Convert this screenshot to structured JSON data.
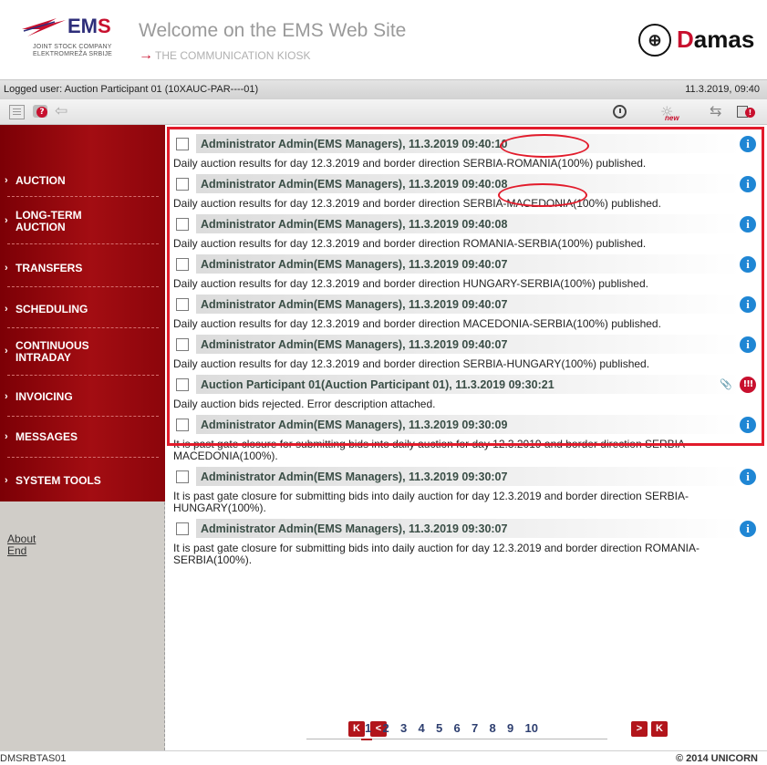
{
  "header": {
    "brand_word_1": "EM",
    "brand_word_2": "S",
    "company_line_1": "JOINT STOCK COMPANY",
    "company_line_2": "ELEKTROMREŽA SRBIJE",
    "welcome": "Welcome on the EMS Web Site",
    "kiosk": "THE COMMUNICATION KIOSK",
    "partner_logo_1": "D",
    "partner_logo_2": "amas"
  },
  "status": {
    "logged_user": "Logged user: Auction Participant 01 (10XAUC-PAR----01)",
    "datetime": "11.3.2019, 09:40"
  },
  "toolbar": {
    "icons": [
      "document-icon",
      "help-icon",
      "back-arrow-icon",
      "clock-icon",
      "new-bulb-icon",
      "swap-arrows-icon",
      "book-alert-icon"
    ],
    "bulb_badge": "new"
  },
  "sidebar": {
    "menu": [
      {
        "label_1": "AUCTION",
        "label_2": ""
      },
      {
        "label_1": "LONG-TERM",
        "label_2": "AUCTION"
      },
      {
        "label_1": "TRANSFERS",
        "label_2": ""
      },
      {
        "label_1": "SCHEDULING",
        "label_2": ""
      },
      {
        "label_1": "CONTINUOUS",
        "label_2": "INTRADAY"
      },
      {
        "label_1": "INVOICING",
        "label_2": ""
      },
      {
        "label_1": "MESSAGES",
        "label_2": ""
      },
      {
        "label_1": "SYSTEM TOOLS",
        "label_2": ""
      }
    ],
    "chevron": "›",
    "about": "About",
    "end": "End"
  },
  "messages": [
    {
      "title": "Administrator Admin(EMS Managers), 11.3.2019 09:40:10",
      "body": "Daily auction results for day 12.3.2019 and border direction SERBIA-ROMANIA(100%) published.",
      "icon": "info"
    },
    {
      "title": "Administrator Admin(EMS Managers), 11.3.2019 09:40:08",
      "body": "Daily auction results for day 12.3.2019 and border direction SERBIA-MACEDONIA(100%) published.",
      "icon": "info"
    },
    {
      "title": "Administrator Admin(EMS Managers), 11.3.2019 09:40:08",
      "body": "Daily auction results for day 12.3.2019 and border direction ROMANIA-SERBIA(100%) published.",
      "icon": "info"
    },
    {
      "title": "Administrator Admin(EMS Managers), 11.3.2019 09:40:07",
      "body": "Daily auction results for day 12.3.2019 and border direction HUNGARY-SERBIA(100%) published.",
      "icon": "info"
    },
    {
      "title": "Administrator Admin(EMS Managers), 11.3.2019 09:40:07",
      "body": "Daily auction results for day 12.3.2019 and border direction MACEDONIA-SERBIA(100%) published.",
      "icon": "info"
    },
    {
      "title": "Administrator Admin(EMS Managers), 11.3.2019 09:40:07",
      "body": "Daily auction results for day 12.3.2019 and border direction SERBIA-HUNGARY(100%) published.",
      "icon": "info"
    },
    {
      "title": "Auction Participant 01(Auction Participant 01), 11.3.2019 09:30:21",
      "body": "Daily auction bids rejected. Error description attached.",
      "icon": "error",
      "attachment": true
    },
    {
      "title": "Administrator Admin(EMS Managers), 11.3.2019 09:30:09",
      "body": "It is past gate closure for submitting bids into daily auction for day 12.3.2019 and border direction SERBIA-MACEDONIA(100%).",
      "icon": "info"
    },
    {
      "title": "Administrator Admin(EMS Managers), 11.3.2019 09:30:07",
      "body": "It is past gate closure for submitting bids into daily auction for day 12.3.2019 and border direction SERBIA-HUNGARY(100%).",
      "icon": "info"
    },
    {
      "title": "Administrator Admin(EMS Managers), 11.3.2019 09:30:07",
      "body": "It is past gate closure for submitting bids into daily auction for day 12.3.2019 and border direction ROMANIA-SERBIA(100%).",
      "icon": "info"
    }
  ],
  "pager": {
    "first": "K",
    "prev": "<",
    "next": ">",
    "last": "K",
    "pages": [
      "1",
      "2",
      "3",
      "4",
      "5",
      "6",
      "7",
      "8",
      "9",
      "10"
    ],
    "current": "1"
  },
  "footer": {
    "id": "DMSRBTAS01",
    "copyright": "© 2014 UNICORN"
  },
  "colors": {
    "accent_red": "#c8102e",
    "menu_red": "#a30d12",
    "title_green": "#3a4e46",
    "info_blue": "#1f86d4",
    "highlight_red": "#e21b2b"
  }
}
